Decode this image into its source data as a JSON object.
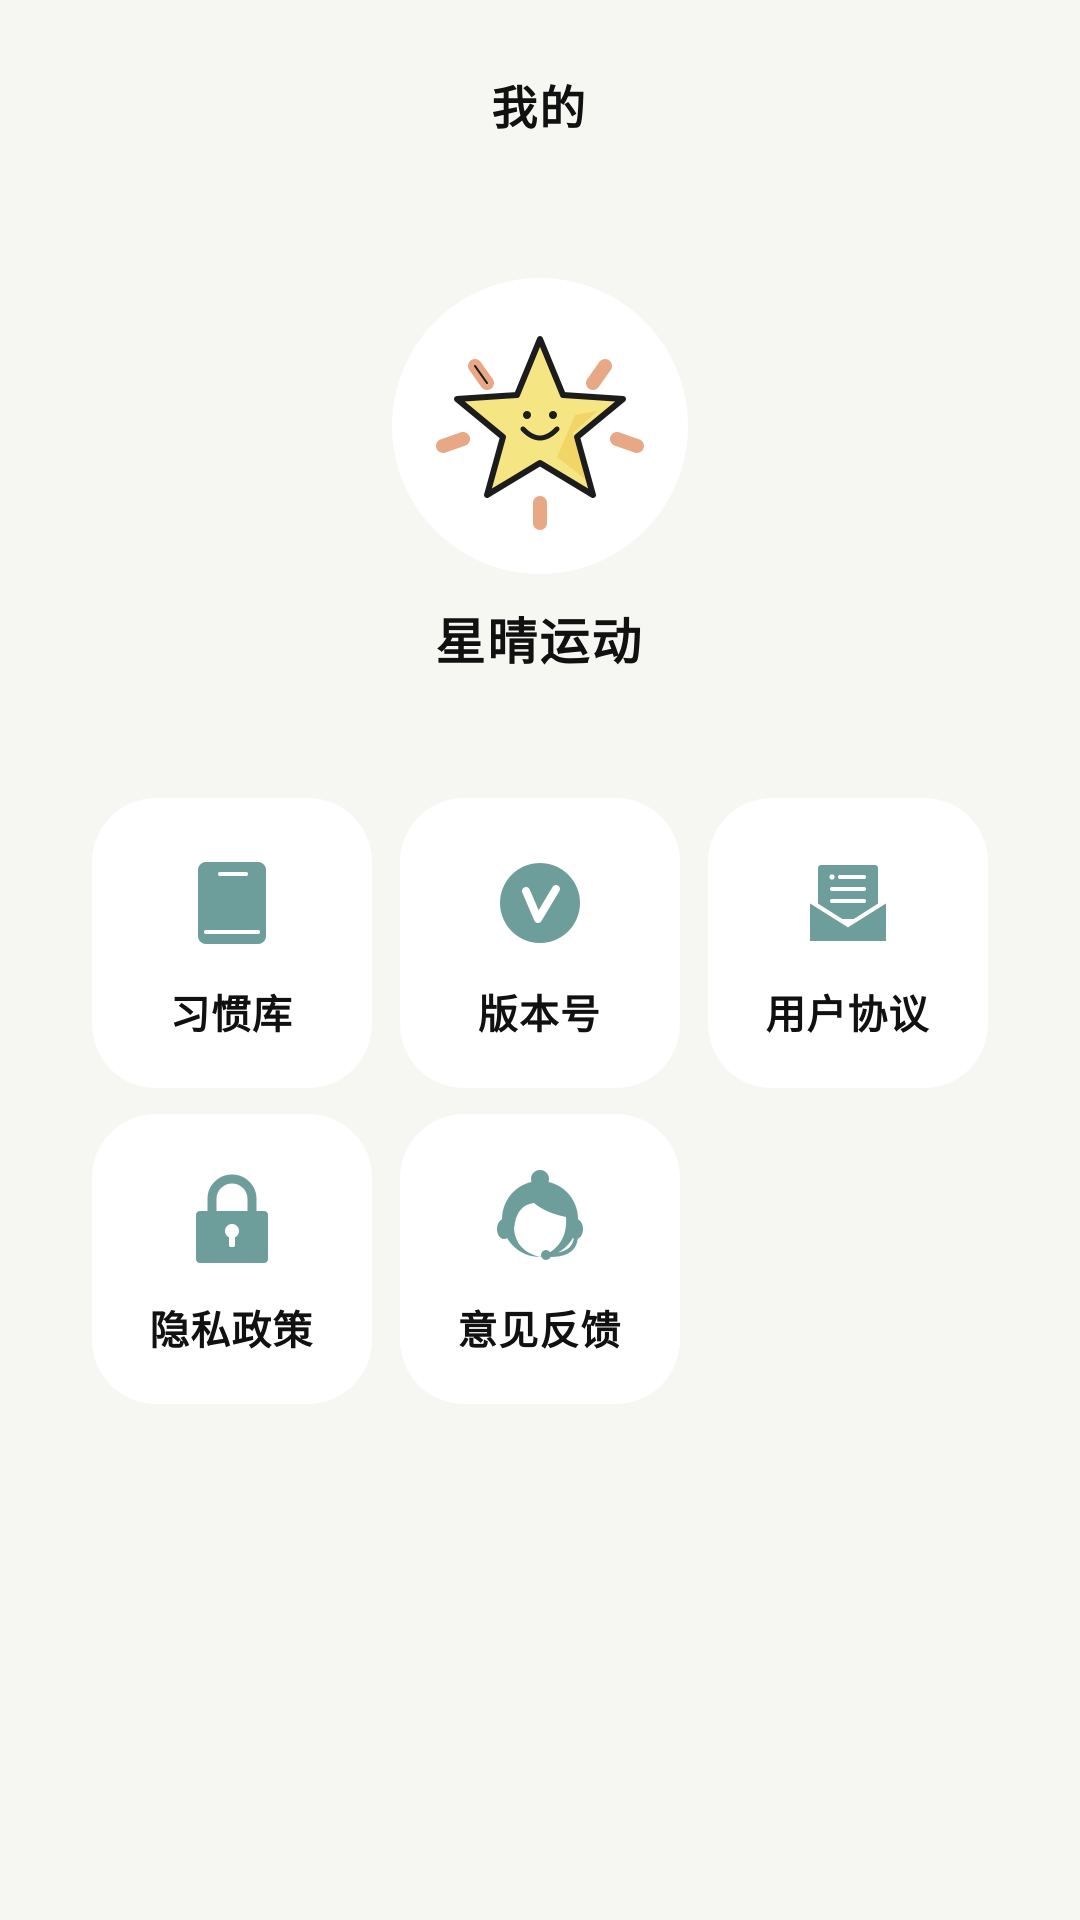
{
  "header": {
    "title": "我的"
  },
  "profile": {
    "avatar_icon": "smiling-star-icon",
    "name": "星晴运动"
  },
  "theme": {
    "accent": "#6e9e9b",
    "card_bg": "#ffffff",
    "page_bg": "#f6f6f2"
  },
  "menu": {
    "items": [
      {
        "label": "习惯库",
        "icon": "book-icon"
      },
      {
        "label": "版本号",
        "icon": "version-v-icon"
      },
      {
        "label": "用户协议",
        "icon": "document-envelope-icon"
      },
      {
        "label": "隐私政策",
        "icon": "lock-icon"
      },
      {
        "label": "意见反馈",
        "icon": "customer-service-icon"
      }
    ]
  }
}
